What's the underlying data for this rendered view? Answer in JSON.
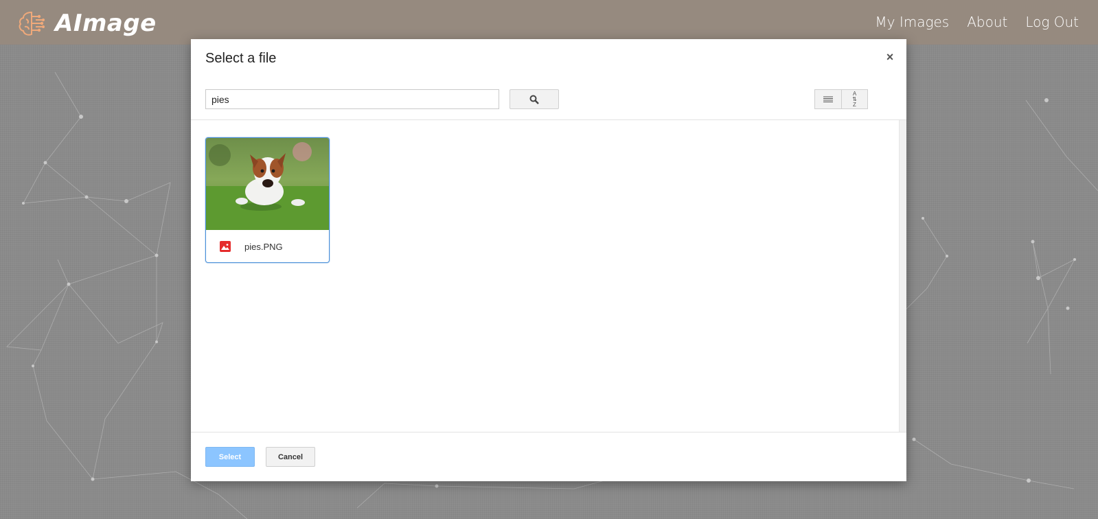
{
  "header": {
    "brand_name": "AImage",
    "nav": [
      "My Images",
      "About",
      "Log Out"
    ],
    "background_color": "#968a7f",
    "logo_color": "#f0a97a"
  },
  "dialog": {
    "title": "Select a file",
    "close_label": "×",
    "search": {
      "value": "pies",
      "icon": "search-icon"
    },
    "view_buttons": [
      {
        "icon": "list-view-icon"
      },
      {
        "icon": "sort-az-icon",
        "label_top": "A",
        "label_bottom": "Z"
      }
    ],
    "files": [
      {
        "name": "pies.PNG",
        "icon": "image-file-icon",
        "selected": true,
        "icon_color": "#e52b2b"
      }
    ],
    "buttons": {
      "select": "Select",
      "cancel": "Cancel"
    },
    "select_color": "#8cc5ff"
  }
}
